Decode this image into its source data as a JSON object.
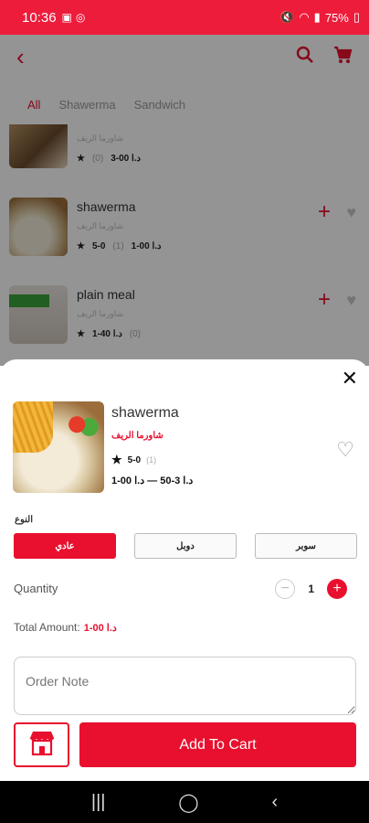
{
  "status": {
    "time": "10:36",
    "battery": "75%"
  },
  "tabs": [
    {
      "label": "All"
    },
    {
      "label": "Shawerma"
    },
    {
      "label": "Sandwich"
    }
  ],
  "list": [
    {
      "name": "",
      "restaurant": "شاورما الريف",
      "rating": "",
      "count": "(0)",
      "price": "3-00 د.ا"
    },
    {
      "name": "shawerma",
      "restaurant": "شاورما الريف",
      "rating": "5-0",
      "count": "(1)",
      "price": "1-00 د.ا"
    },
    {
      "name": "plain meal",
      "restaurant": "شاورما الريف",
      "rating": "",
      "count": "(0)",
      "price": "1-40 د.ا"
    }
  ],
  "product": {
    "name": "shawerma",
    "restaurant": "شاورما الريف",
    "rating": "5-0",
    "rating_count": "(1)",
    "price": "1-00 د.ا 3-50 — د.ا"
  },
  "options": {
    "label": "النوع",
    "items": [
      {
        "label": "عادي"
      },
      {
        "label": "دوبل"
      },
      {
        "label": "سوبر"
      }
    ]
  },
  "quantity": {
    "label": "Quantity",
    "value": "1"
  },
  "total": {
    "label": "Total Amount:",
    "value": "1-00 د.ا"
  },
  "note": {
    "placeholder": "Order Note"
  },
  "cart": {
    "label": "Add To Cart"
  },
  "colors": {
    "brand": "#e8102e",
    "status_bar": "#ee1c3b"
  }
}
